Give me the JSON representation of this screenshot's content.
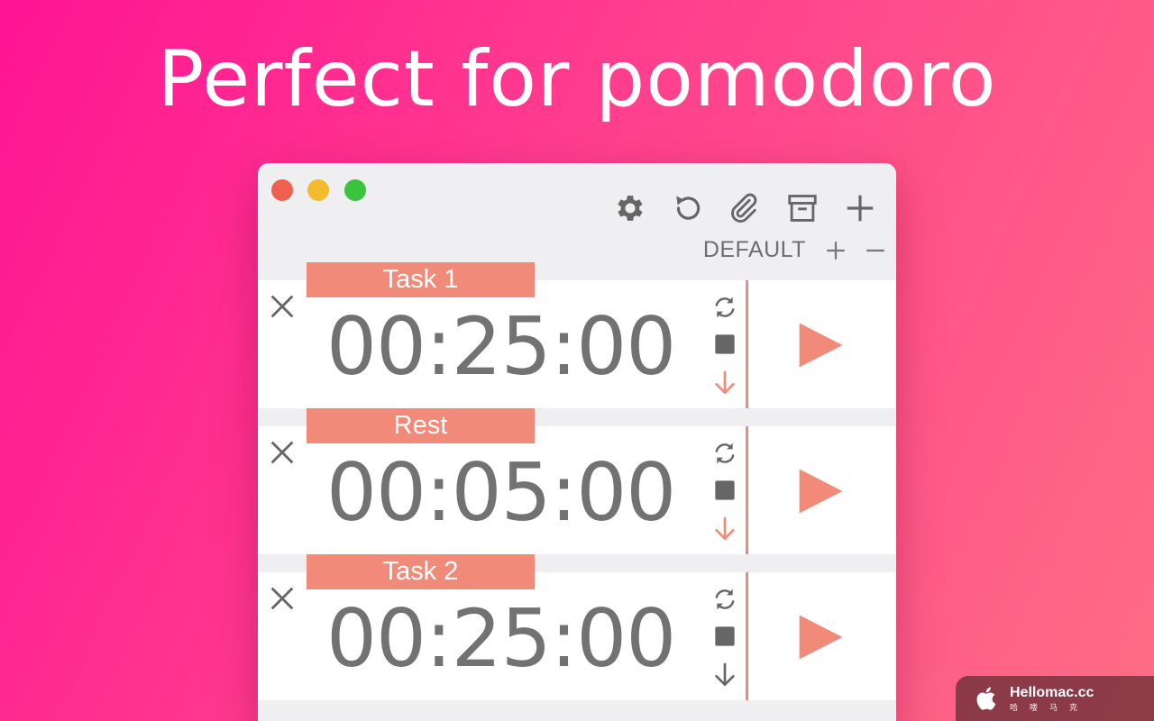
{
  "headline": "Perfect for pomodoro",
  "window": {
    "toolbar": [
      "gear-icon",
      "reset-icon",
      "paperclip-icon",
      "archive-icon",
      "plus-icon"
    ],
    "profile": {
      "name": "DEFAULT"
    }
  },
  "timers": [
    {
      "label": "Task 1",
      "time": "00:25:00",
      "down_color": "#f28a7a"
    },
    {
      "label": "Rest",
      "time": "00:05:00",
      "down_color": "#f28a7a"
    },
    {
      "label": "Task 2",
      "time": "00:25:00",
      "down_color": "#666666"
    }
  ],
  "watermark": {
    "title": "Hellomac.cc",
    "subtitle": "哈喽马克"
  },
  "colors": {
    "accent": "#f28a7a",
    "icon": "#666666",
    "time": "#727272"
  }
}
